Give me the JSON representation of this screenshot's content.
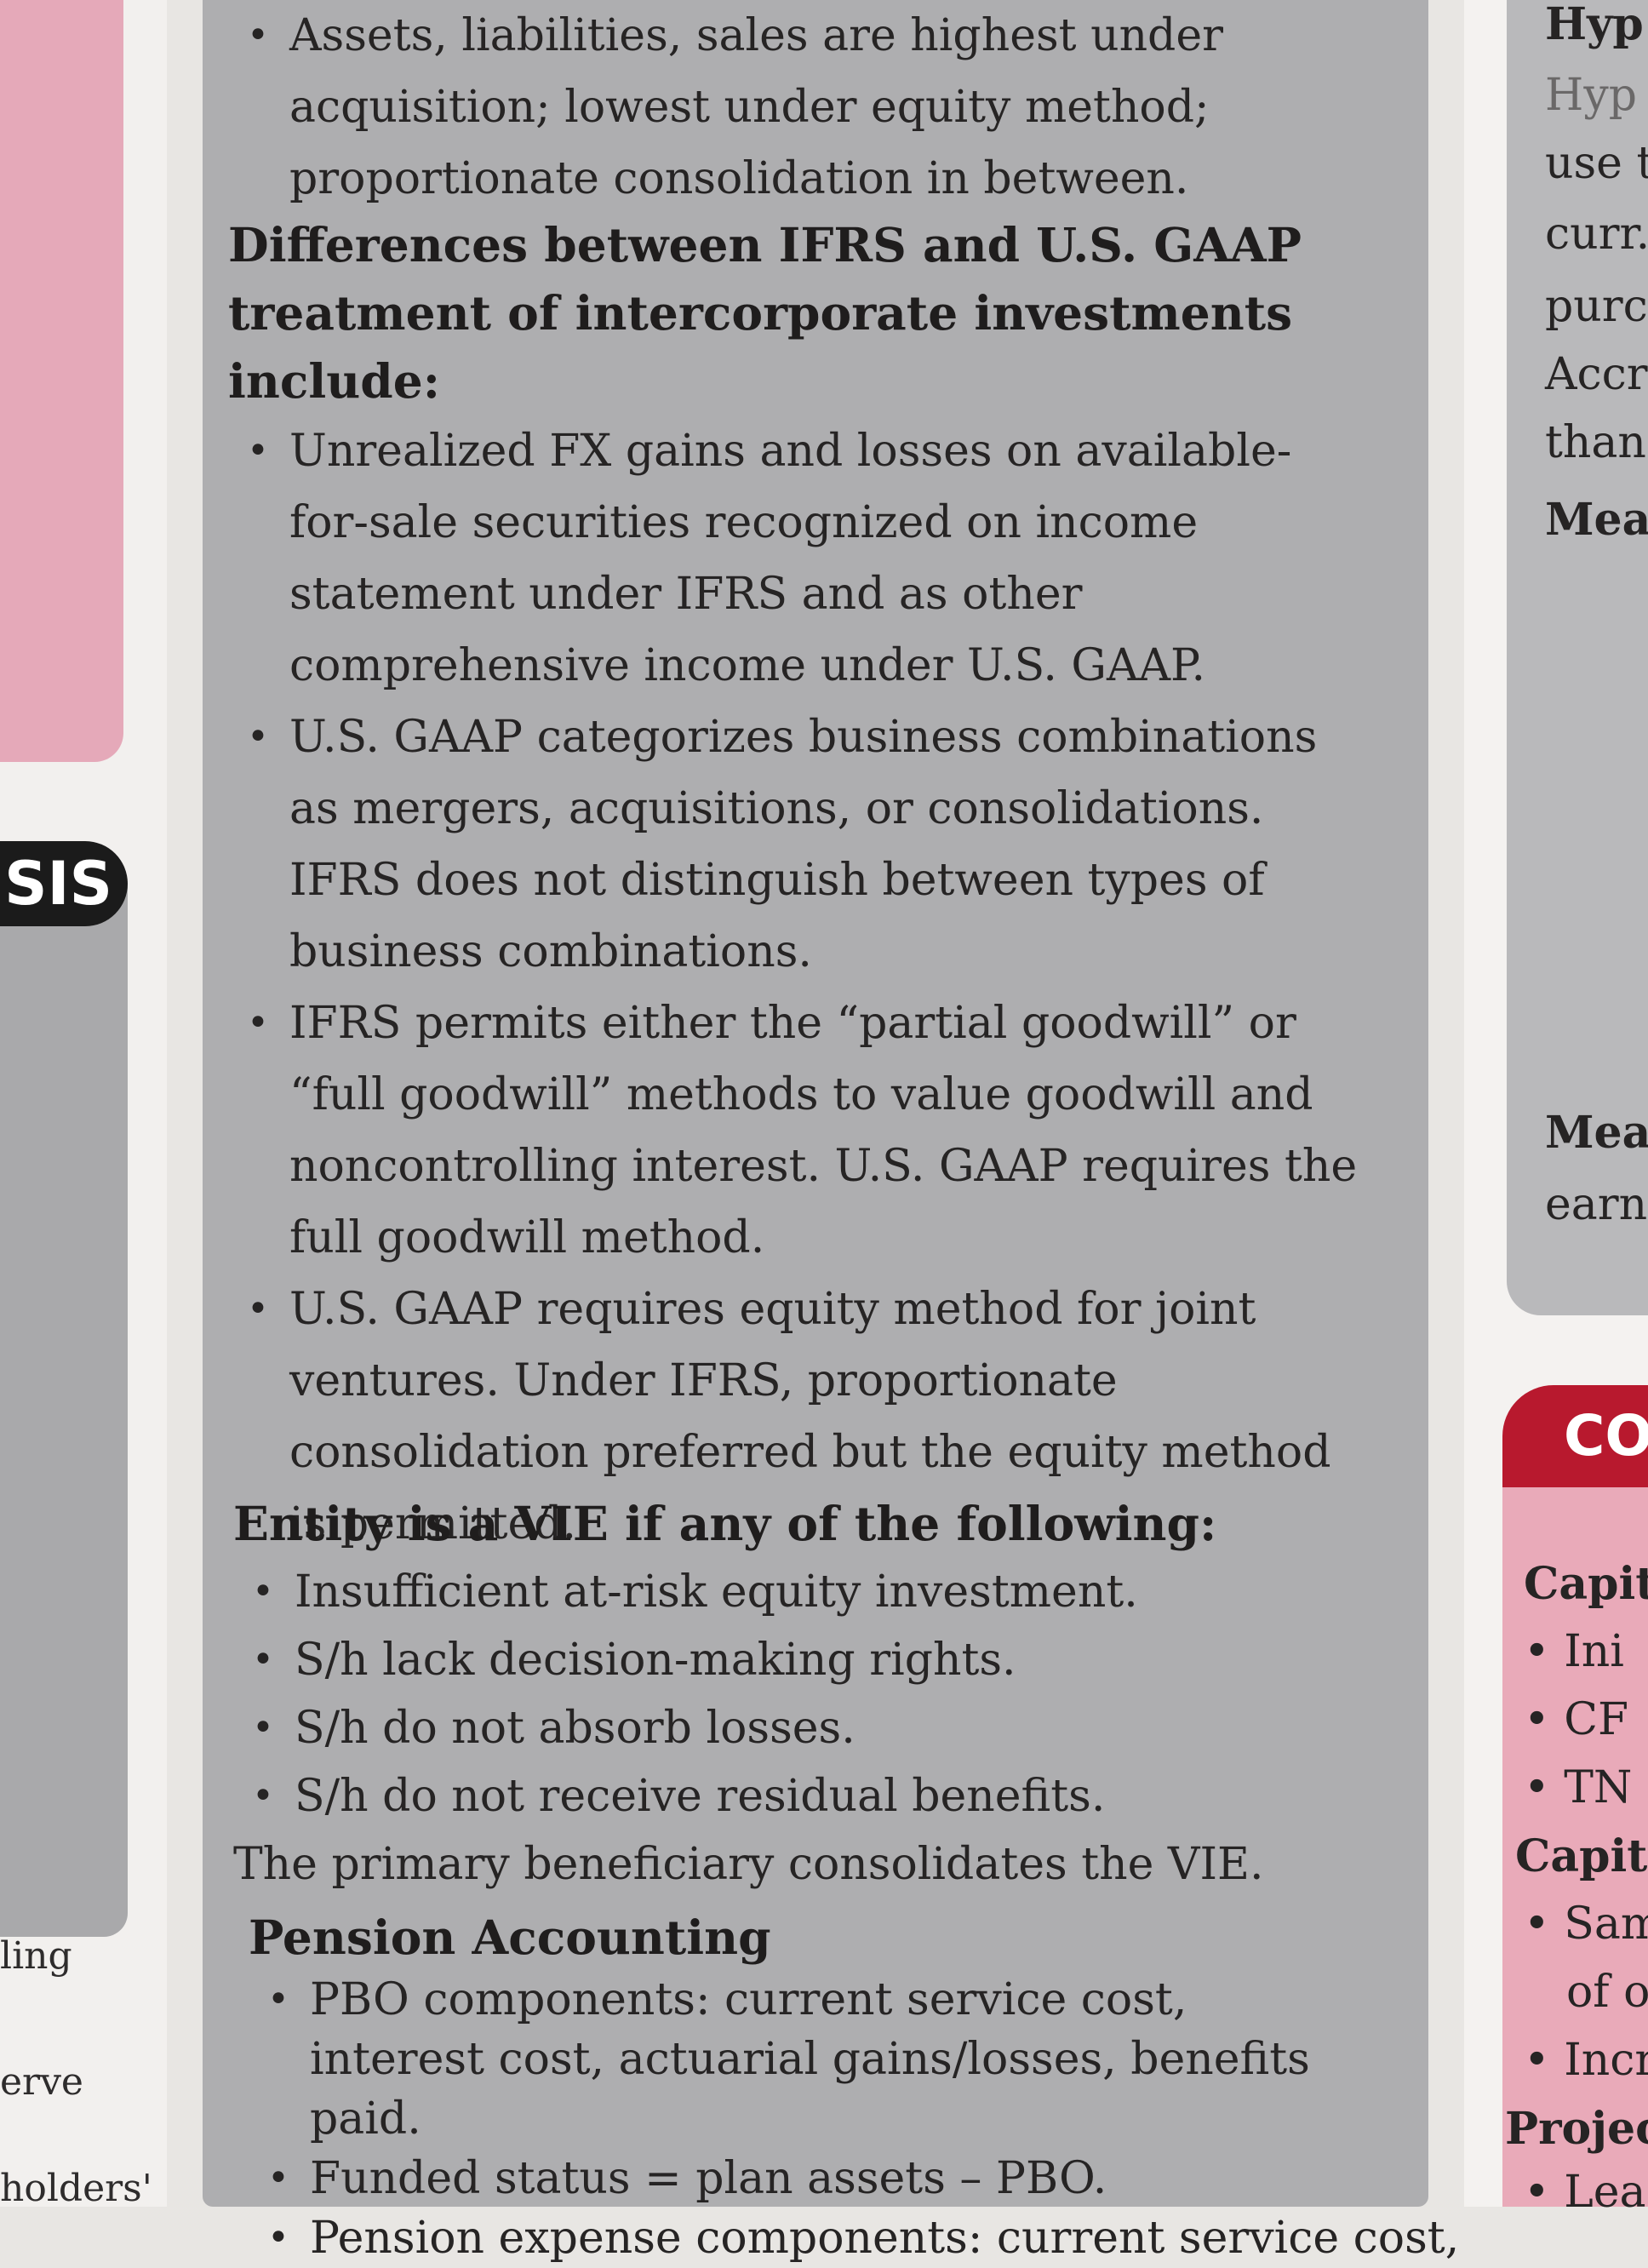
{
  "left": {
    "badge": "SIS",
    "fragments": [
      "ling",
      "erve",
      "holders'"
    ]
  },
  "center": {
    "intro_bullet": "Assets, liabilities, sales are highest under acquisition; lowest under equity method; proportionate consolidation in between.",
    "section1": {
      "heading": "Differences between IFRS and U.S. GAAP treatment of intercorporate investments include:",
      "bullets": [
        "Unrealized FX gains and losses on available-for-sale securities recognized on income statement under IFRS and as other comprehensive income under U.S. GAAP.",
        "U.S. GAAP categorizes business combinations as mergers, acquisitions, or consolidations. IFRS does not distinguish between types of business combinations.",
        "IFRS permits either the “partial goodwill” or “full goodwill” methods to value goodwill and noncontrolling interest. U.S. GAAP requires the full goodwill method.",
        "U.S. GAAP requires equity method for joint ventures. Under IFRS, proportionate consolidation preferred but the equity method is permitted."
      ]
    },
    "section2": {
      "heading": "Entity is a VIE if any of the following:",
      "bullets": [
        "Insufficient at-risk equity investment.",
        "S/h lack decision-making rights.",
        "S/h do not absorb losses.",
        "S/h do not receive residual benefits."
      ],
      "closing": "The primary beneficiary consolidates the VIE."
    },
    "section3": {
      "heading": "Pension Accounting",
      "bullets": [
        "PBO components: current service cost, interest cost, actuarial gains/losses, benefits paid.",
        "Funded status = plan assets – PBO.",
        "Pension expense components: current service cost,"
      ]
    }
  },
  "right": {
    "badge": "CO",
    "top_lines": [
      "Hyp",
      "Hyp",
      "use t",
      "curr.",
      "purc",
      "Accr",
      "than"
    ],
    "mea1": "Mea",
    "mea2": "Mea",
    "earni": "earni",
    "pink_lines": [
      "Capit",
      "Ini",
      "CF",
      "TN",
      "Capita",
      "Sam",
      "of o",
      "Incr",
      "Project",
      "Leas"
    ]
  },
  "bullet_glyph": "•"
}
